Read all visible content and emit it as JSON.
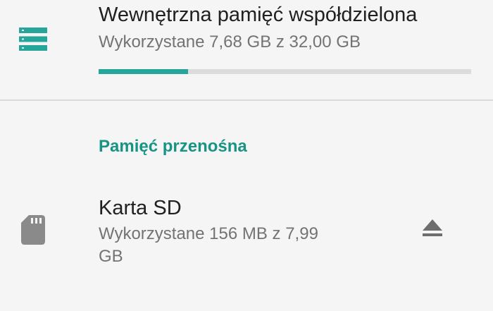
{
  "internal_storage": {
    "icon": "storage-icon",
    "title": "Wewnętrzna pamięć współdzielona",
    "usage": "Wykorzystane 7,68  GB z 32,00  GB",
    "progress_fraction": 0.24,
    "progress_color": "#26a69a"
  },
  "portable_section": {
    "header": "Pamięć przenośna",
    "header_color": "#179483"
  },
  "sd_card": {
    "icon": "sd-card-icon",
    "title": "Karta SD",
    "usage": "Wykorzystane 156  MB z 7,99  GB",
    "action_icon": "eject-icon"
  }
}
